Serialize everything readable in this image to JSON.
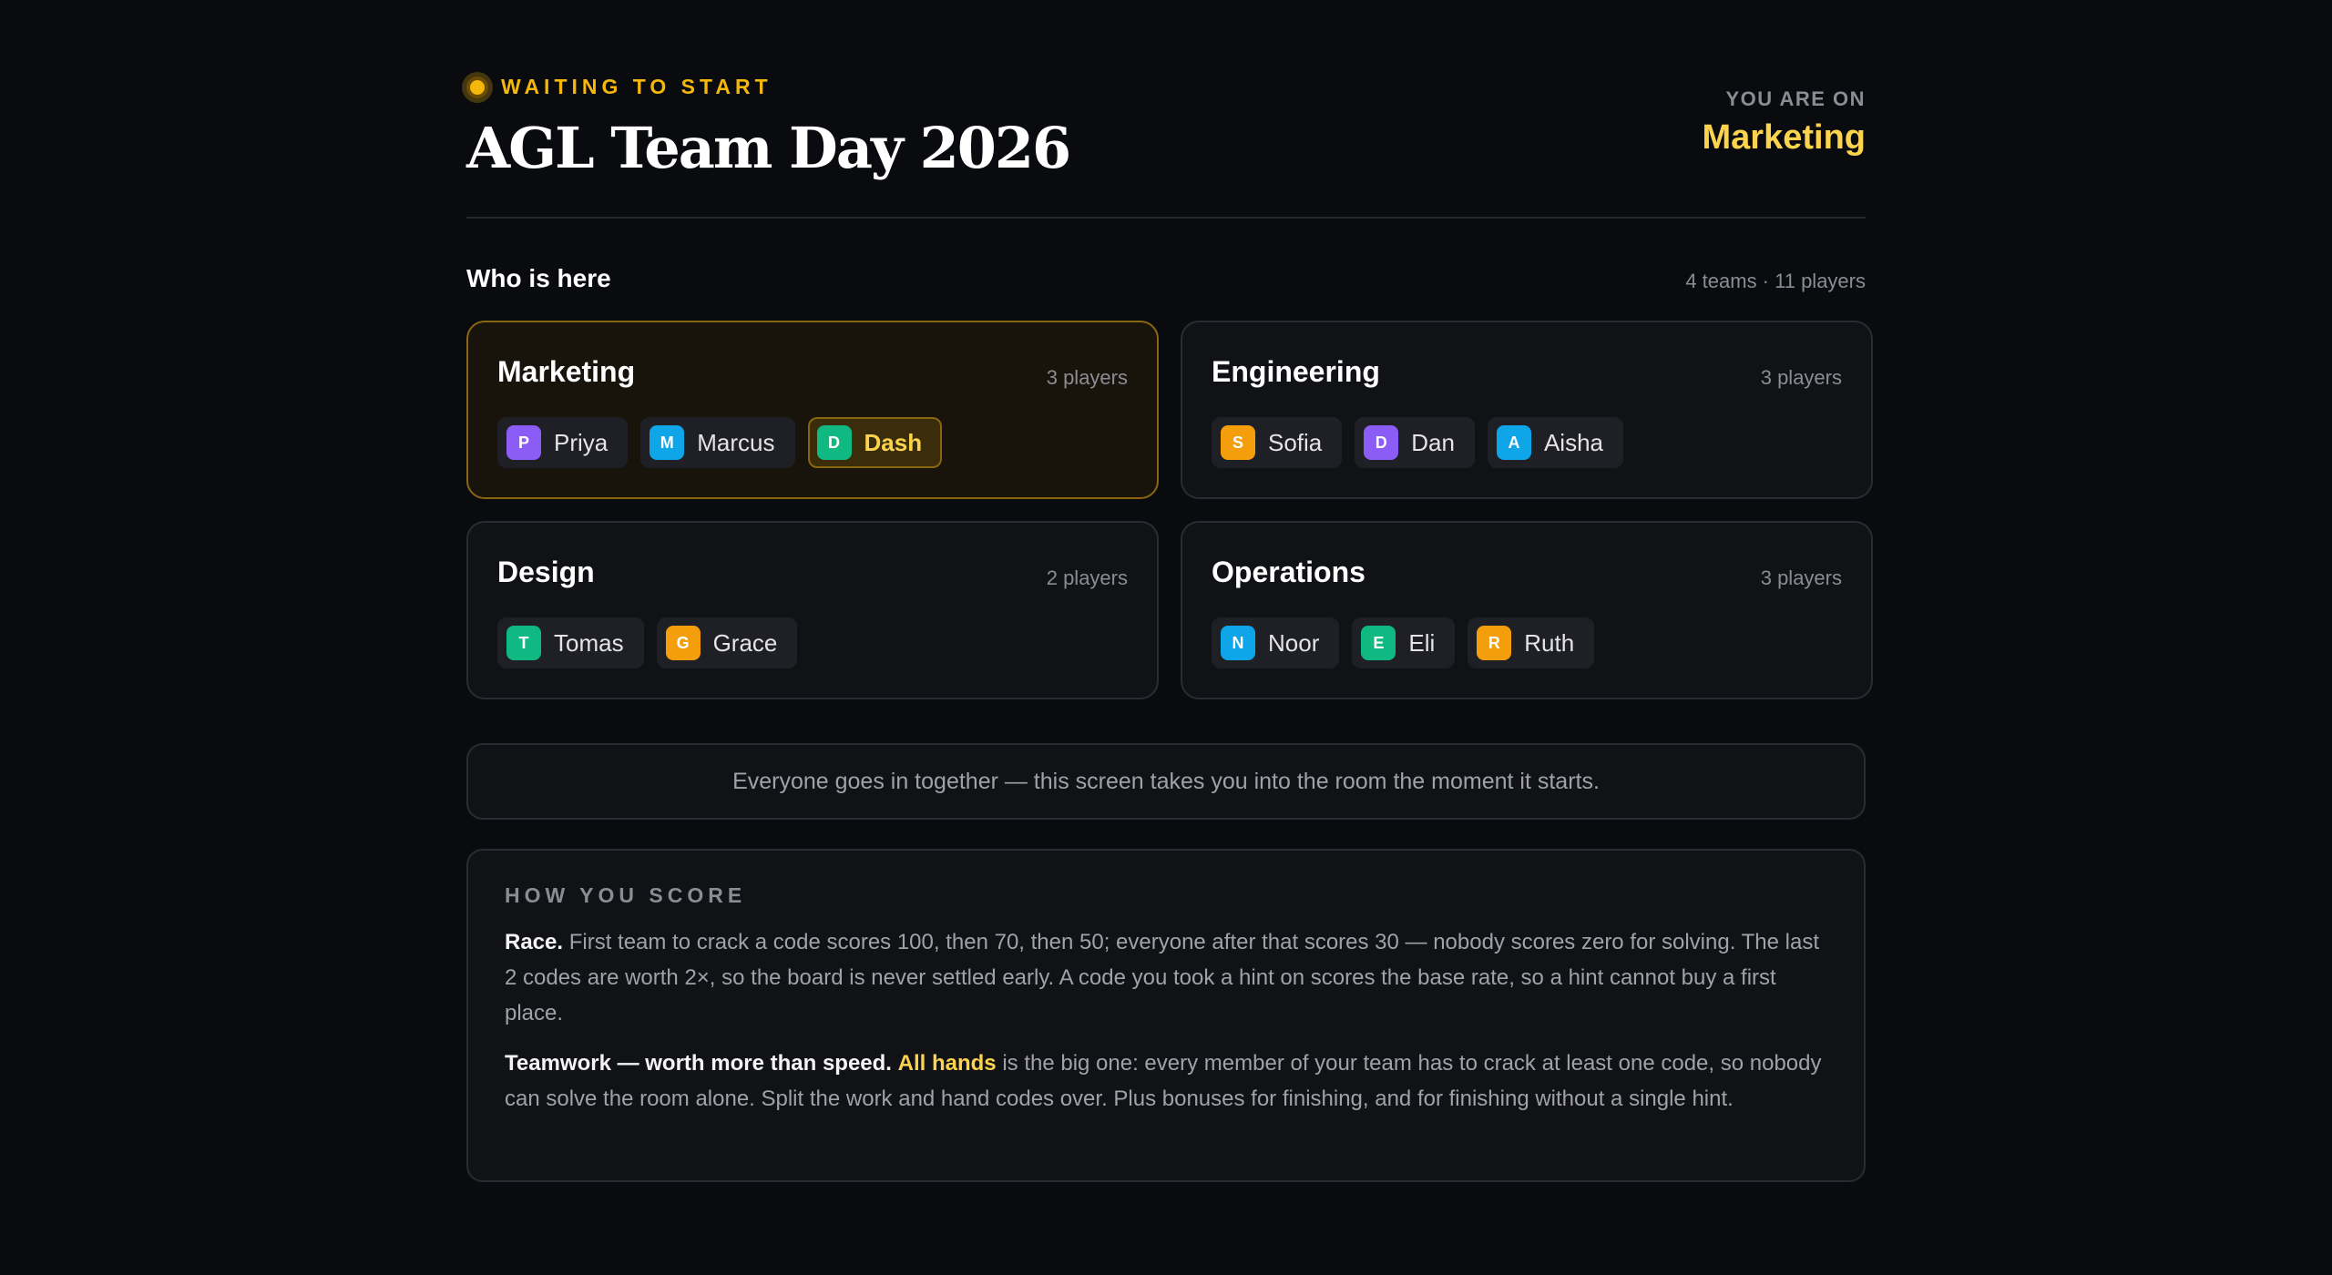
{
  "header": {
    "status": "WAITING TO START",
    "title": "AGL Team Day 2026",
    "you_are_on_label": "YOU ARE ON",
    "your_team": "Marketing"
  },
  "roster": {
    "heading": "Who is here",
    "summary": "4 teams · 11 players",
    "teams": [
      {
        "name": "Marketing",
        "count": "3 players",
        "mine": true,
        "players": [
          {
            "initial": "P",
            "name": "Priya",
            "color": "#8b5cf6"
          },
          {
            "initial": "M",
            "name": "Marcus",
            "color": "#0ea5e9"
          },
          {
            "initial": "D",
            "name": "Dash",
            "color": "#10b981",
            "me": true
          }
        ]
      },
      {
        "name": "Engineering",
        "count": "3 players",
        "players": [
          {
            "initial": "S",
            "name": "Sofia",
            "color": "#f59e0b"
          },
          {
            "initial": "D",
            "name": "Dan",
            "color": "#8b5cf6"
          },
          {
            "initial": "A",
            "name": "Aisha",
            "color": "#0ea5e9"
          }
        ]
      },
      {
        "name": "Design",
        "count": "2 players",
        "players": [
          {
            "initial": "T",
            "name": "Tomas",
            "color": "#10b981"
          },
          {
            "initial": "G",
            "name": "Grace",
            "color": "#f59e0b"
          }
        ]
      },
      {
        "name": "Operations",
        "count": "3 players",
        "players": [
          {
            "initial": "N",
            "name": "Noor",
            "color": "#0ea5e9"
          },
          {
            "initial": "E",
            "name": "Eli",
            "color": "#10b981"
          },
          {
            "initial": "R",
            "name": "Ruth",
            "color": "#f59e0b"
          }
        ]
      }
    ]
  },
  "info": "Everyone goes in together — this screen takes you into the room the moment it starts.",
  "scoring": {
    "heading": "HOW YOU SCORE",
    "race_label": "Race.",
    "race_text": " First team to crack a code scores 100, then 70, then 50; everyone after that scores 30 — nobody scores zero for solving. The last 2 codes are worth 2×, so the board is never settled early. A code you took a hint on scores the base rate, so a hint cannot buy a first place.",
    "teamwork_label": "Teamwork — worth more than speed.",
    "teamwork_highlight": "All hands",
    "teamwork_text": " is the big one: every member of your team has to crack at least one code, so nobody can solve the room alone. Split the work and hand codes over. Plus bonuses for finishing, and for finishing without a single hint."
  },
  "colors": {
    "accent": "#f5b70a",
    "highlight": "#fcd34d",
    "background": "#0a0b0f"
  }
}
